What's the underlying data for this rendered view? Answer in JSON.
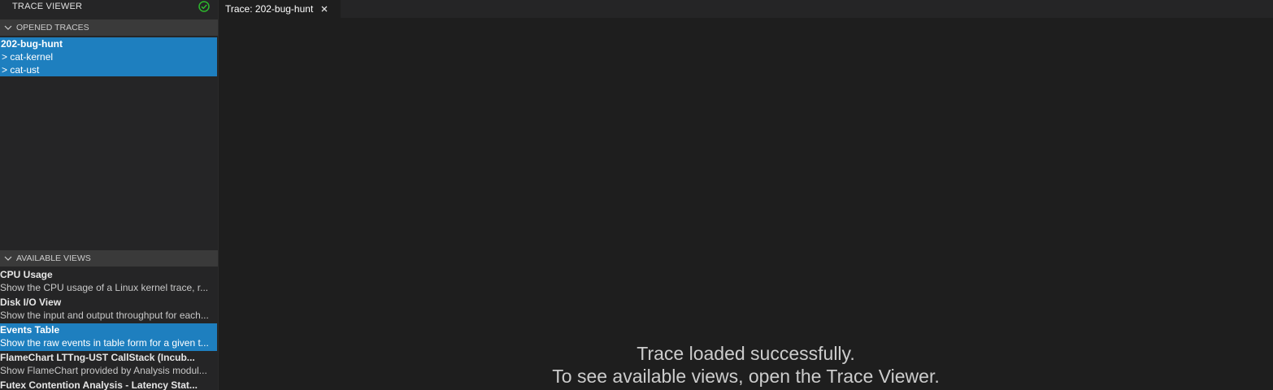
{
  "sidebar": {
    "title": "TRACE VIEWER",
    "status_icon": "check-circle-icon",
    "opened_traces": {
      "header": "OPENED TRACES",
      "items": [
        {
          "label": "202-bug-hunt"
        },
        {
          "label": "> cat-kernel"
        },
        {
          "label": "> cat-ust"
        }
      ]
    },
    "available_views": {
      "header": "AVAILABLE VIEWS",
      "items": [
        {
          "title": "CPU Usage",
          "desc": "Show the CPU usage of a Linux kernel trace, r..."
        },
        {
          "title": "Disk I/O View",
          "desc": "Show the input and output throughput for each..."
        },
        {
          "title": "Events Table",
          "desc": "Show the raw events in table form for a given t..."
        },
        {
          "title": "FlameChart LTTng-UST CallStack (Incub...",
          "desc": "Show FlameChart provided by Analysis modul..."
        },
        {
          "title": "Futex Contention Analysis - Latency Stat...",
          "desc": ""
        }
      ]
    }
  },
  "editor": {
    "tab_label": "Trace: 202-bug-hunt",
    "message_line1": "Trace loaded successfully.",
    "message_line2": "To see available views, open the Trace Viewer."
  },
  "colors": {
    "selection": "#1e7fbf",
    "success": "#2db82d",
    "background": "#1e1e1e",
    "sidebar": "#252526"
  }
}
